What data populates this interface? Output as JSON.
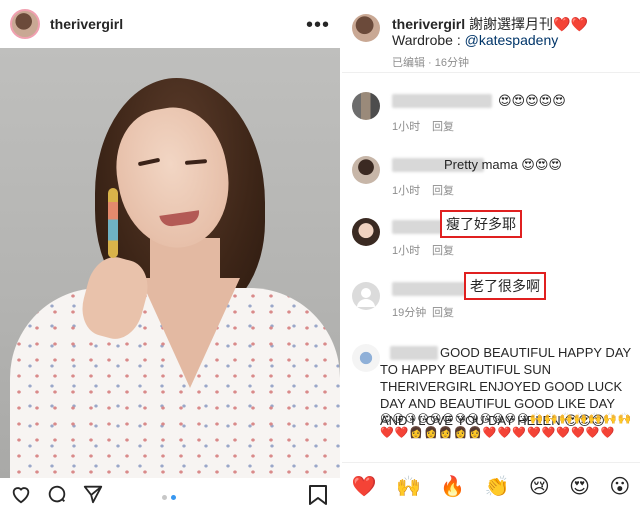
{
  "post": {
    "username": "therivergirl",
    "more": "•••"
  },
  "left_actions": {
    "like": "heart-outline-icon",
    "comment": "comment-icon",
    "share": "send-icon",
    "save": "bookmark-icon"
  },
  "caption": {
    "username": "therivergirl",
    "text": " 謝謝選擇月刊❤️❤️",
    "wardrobe_label": "Wardrobe : ",
    "wardrobe_handle": "@katespadeny",
    "meta": "已编辑 · 16分钟"
  },
  "comments": [
    {
      "text": "😍😍😍😍😍",
      "time": "1小时",
      "reply": "回复"
    },
    {
      "text": "Pretty mama 😍😍😍",
      "time": "1小时",
      "reply": "回复"
    },
    {
      "text": "瘦了好多耶",
      "time": "1小时",
      "reply": "回复"
    },
    {
      "text": "老了很多啊",
      "time": "19分钟",
      "reply": "回复"
    },
    {
      "text": "GOOD BEAUTIFUL HAPPY DAY TO HAPPY BEAUTIFUL SUN THERIVERGIRL ENJOYED GOOD LUCK DAY AND BEAUTIFUL GOOD LIKE DAY AND I LOVE YOU DAY HELEN 😍😍😍",
      "emoji": "😍😘😘😘😘😘😘😘😘😘😘😘🙌🙌🙌🙌🙌🙌🙌❤️❤️👩👩👩👩👩❤️❤️❤️❤️❤️❤️❤️❤️❤️"
    }
  ],
  "quick_reactions": [
    "❤️",
    "🙌",
    "🔥",
    "👏",
    "😢",
    "😍",
    "😮"
  ]
}
